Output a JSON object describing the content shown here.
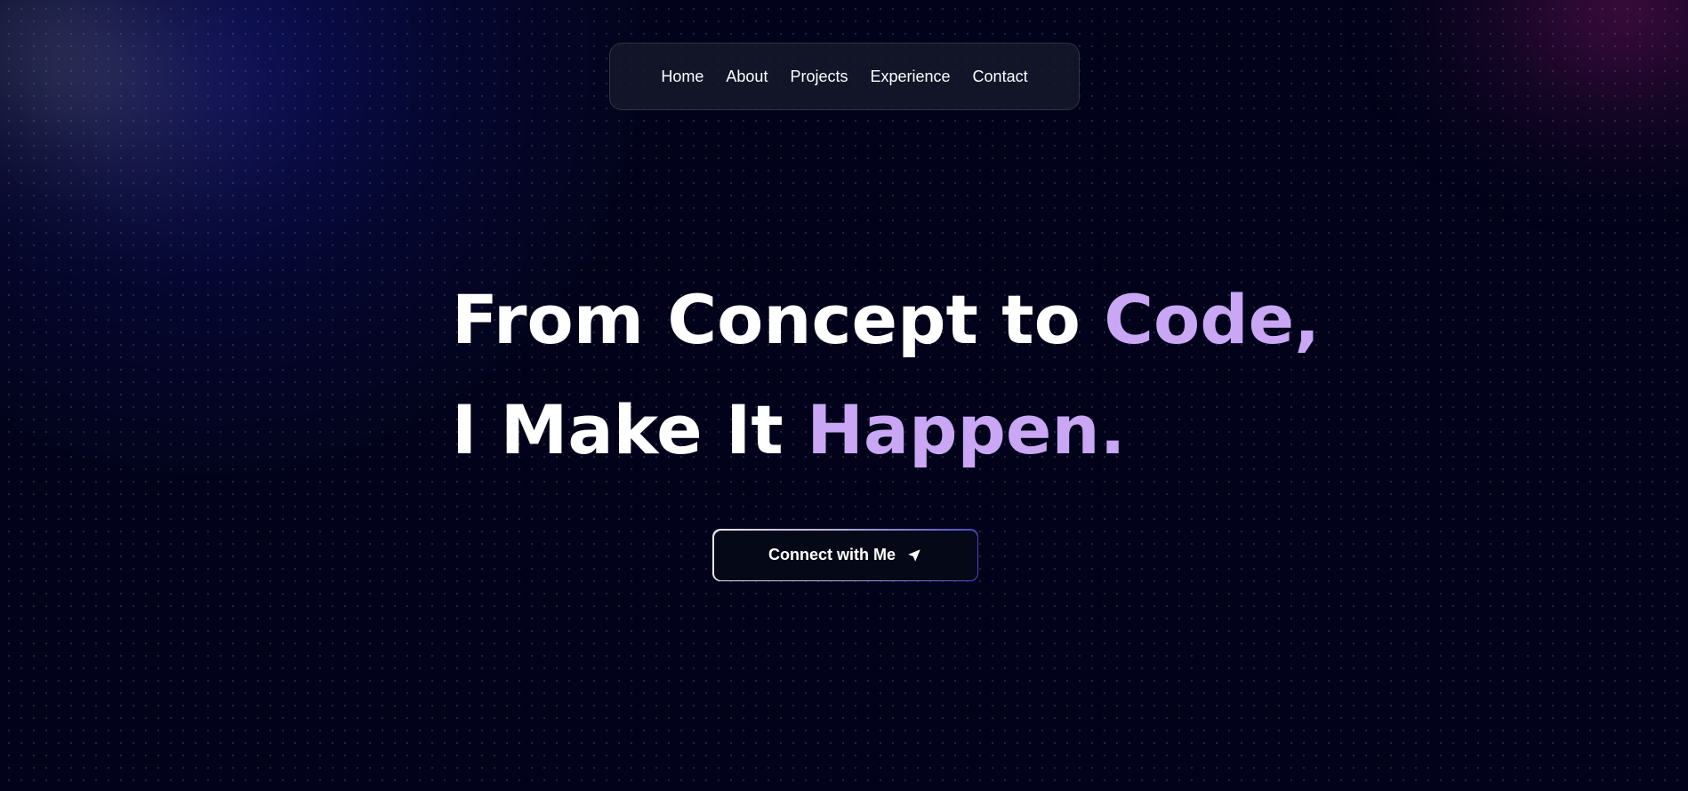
{
  "nav": {
    "items": [
      {
        "label": "Home"
      },
      {
        "label": "About"
      },
      {
        "label": "Projects"
      },
      {
        "label": "Experience"
      },
      {
        "label": "Contact"
      }
    ]
  },
  "hero": {
    "line1_plain": "From Concept to ",
    "line1_accent": "Code,",
    "line2_plain": "I Make It ",
    "line2_accent": "Happen."
  },
  "cta": {
    "label": "Connect with Me",
    "icon": "send-icon"
  },
  "colors": {
    "background": "#02031a",
    "accent": "#c9a7f5",
    "text": "#ffffff"
  }
}
